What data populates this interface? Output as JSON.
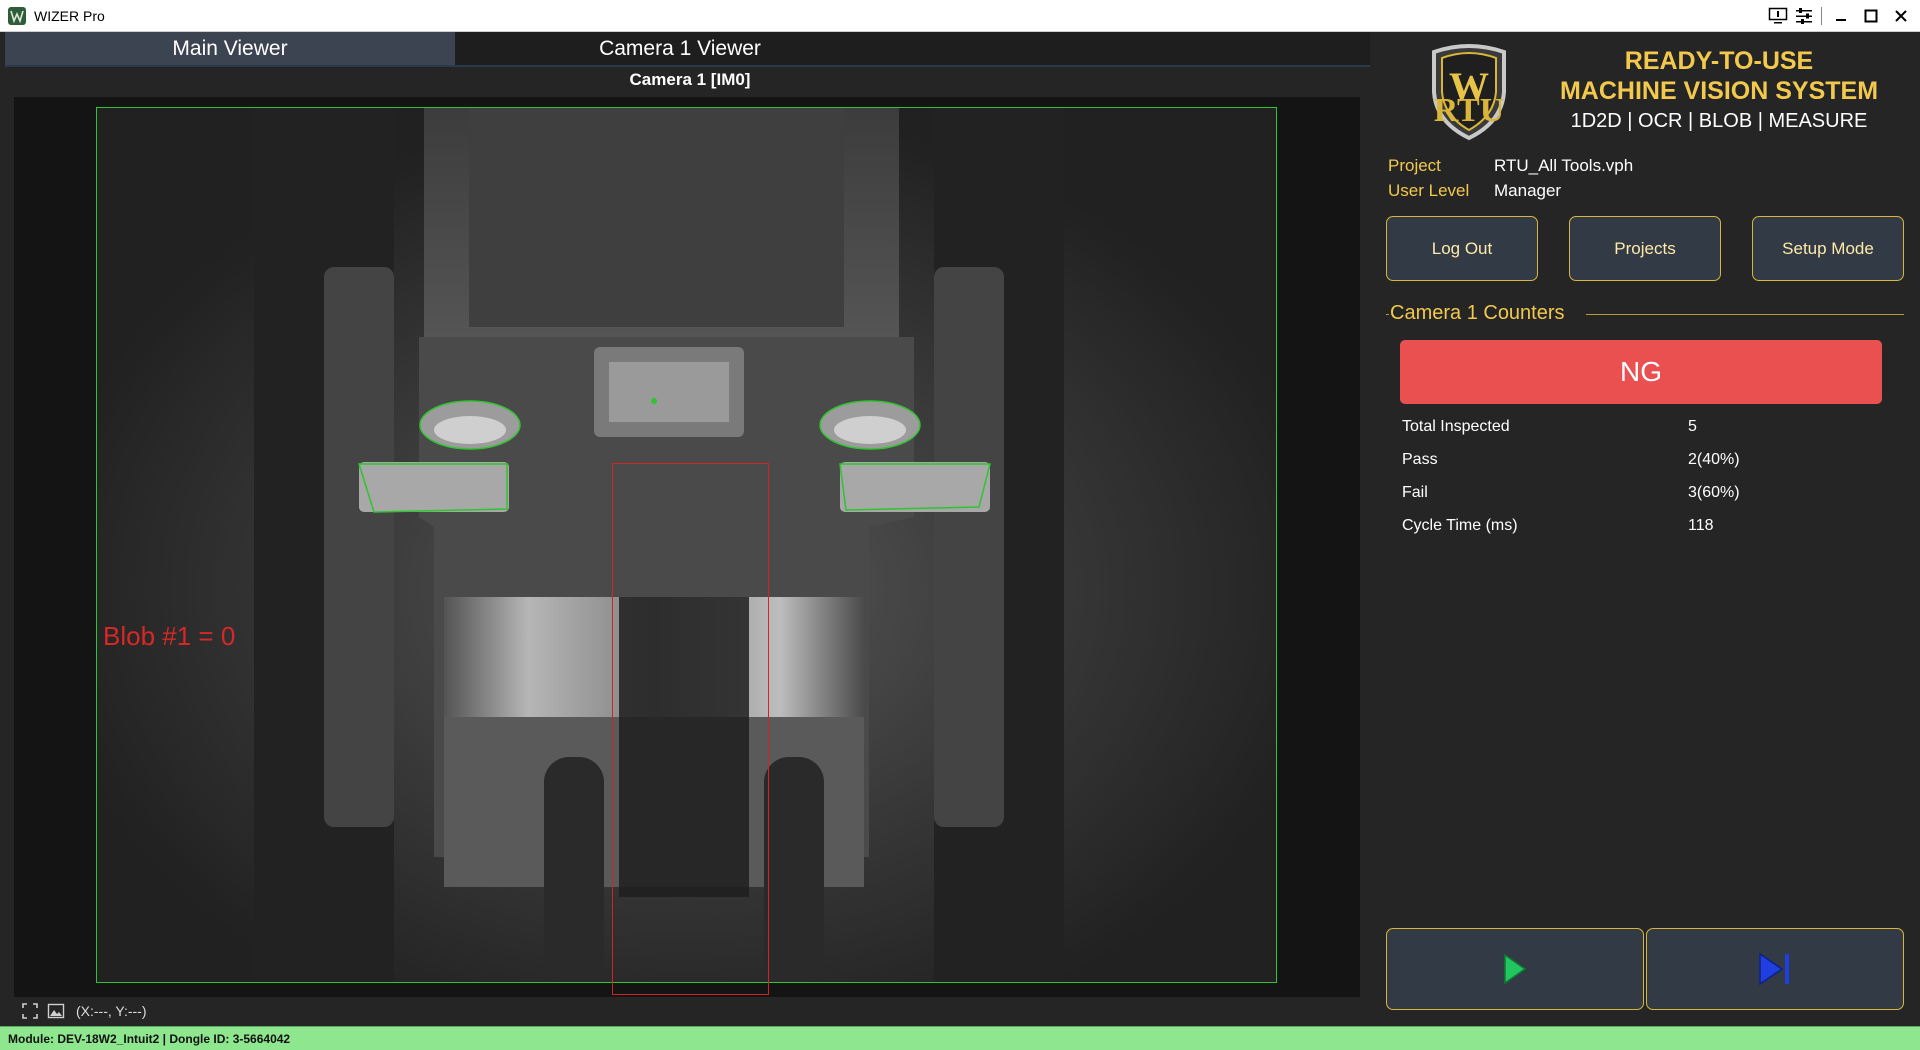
{
  "window": {
    "title": "WIZER Pro"
  },
  "tabs": [
    {
      "label": "Main Viewer",
      "active": true
    },
    {
      "label": "Camera 1 Viewer",
      "active": false
    }
  ],
  "viewer": {
    "title": "Camera 1  [IM0]",
    "blob_result": "Blob #1 = 0",
    "coordinates": "(X:---, Y:---)"
  },
  "brand": {
    "logo_letter": "W",
    "logo_text": "RTU",
    "headline_line1": "READY-TO-USE",
    "headline_line2": "MACHINE VISION SYSTEM",
    "subline": "1D2D | OCR | BLOB | MEASURE"
  },
  "info": {
    "project_label": "Project",
    "project_value": "RTU_All Tools.vph",
    "user_level_label": "User Level",
    "user_level_value": "Manager"
  },
  "buttons": {
    "logout": "Log Out",
    "projects": "Projects",
    "setup_mode": "Setup Mode"
  },
  "counters": {
    "section_title": "Camera 1 Counters",
    "result": "NG",
    "result_color": "#ea5050",
    "rows": [
      {
        "label": "Total Inspected",
        "value": "5"
      },
      {
        "label": "Pass",
        "value": "2(40%)"
      },
      {
        "label": "Fail",
        "value": "3(60%)"
      },
      {
        "label": "Cycle Time (ms)",
        "value": "118"
      }
    ]
  },
  "controls": [
    {
      "icon": "play-icon",
      "color": "#22c55e"
    },
    {
      "icon": "step-forward-icon",
      "color": "#1f3fe0"
    }
  ],
  "status_bar": {
    "text": "Module: DEV-18W2_Intuit2 | Dongle ID: 3-5664042"
  },
  "colors": {
    "accent_gold": "#f2c94c",
    "roi_green": "#2ec52e",
    "roi_red": "#d22424",
    "status_green": "#8ee68e"
  }
}
